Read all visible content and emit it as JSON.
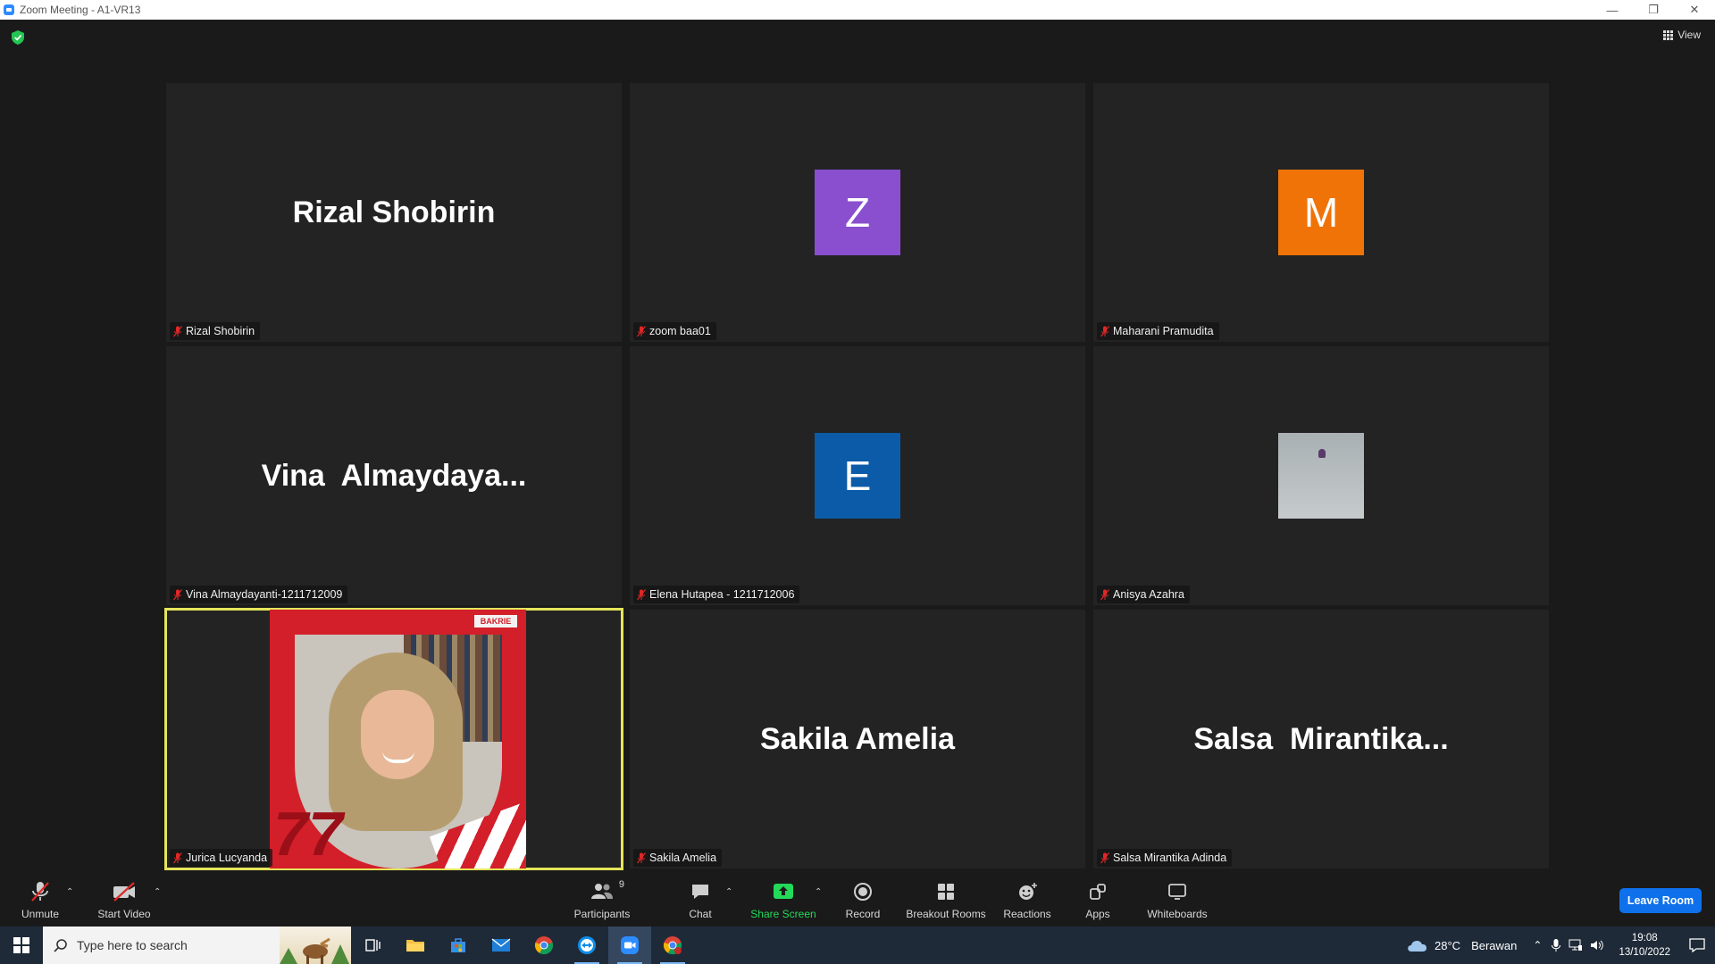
{
  "window": {
    "title": "Zoom Meeting - A1-VR13",
    "minimize": "—",
    "restore": "❐",
    "close": "✕"
  },
  "meeting": {
    "view_label": "View",
    "tiles": [
      {
        "display_name": "Rizal Shobirin",
        "name_tag": "Rizal Shobirin",
        "kind": "name"
      },
      {
        "avatar_letter": "Z",
        "avatar_color": "#8a4fcf",
        "name_tag": "zoom baa01",
        "kind": "letter"
      },
      {
        "avatar_letter": "M",
        "avatar_color": "#f07308",
        "name_tag": "Maharani Pramudita",
        "kind": "letter"
      },
      {
        "display_name": "Vina  Almaydaya...",
        "name_tag": "Vina Almaydayanti-1211712009",
        "kind": "name"
      },
      {
        "avatar_letter": "E",
        "avatar_color": "#0b5ba8",
        "name_tag": "Elena Hutapea - 1211712006",
        "kind": "letter"
      },
      {
        "name_tag": "Anisya Azahra",
        "kind": "photo"
      },
      {
        "name_tag": "Jurica Lucyanda",
        "kind": "video",
        "active_speaker": true,
        "video_badge": "BAKRIE",
        "video_number": "77"
      },
      {
        "display_name": "Sakila Amelia",
        "name_tag": "Sakila Amelia",
        "kind": "name"
      },
      {
        "display_name": "Salsa  Mirantika...",
        "name_tag": "Salsa Mirantika Adinda",
        "kind": "name"
      }
    ]
  },
  "toolbar": {
    "unmute": "Unmute",
    "start_video": "Start Video",
    "participants": "Participants",
    "participants_count": "9",
    "chat": "Chat",
    "share_screen": "Share Screen",
    "record": "Record",
    "breakout_rooms": "Breakout Rooms",
    "reactions": "Reactions",
    "apps": "Apps",
    "whiteboards": "Whiteboards",
    "leave_room": "Leave Room",
    "share_color": "#23d959",
    "leave_color": "#0e71eb"
  },
  "taskbar": {
    "search_placeholder": "Type here to search",
    "weather_temp": "28°C",
    "weather_text": "Berawan",
    "time": "19:08",
    "date": "13/10/2022"
  }
}
